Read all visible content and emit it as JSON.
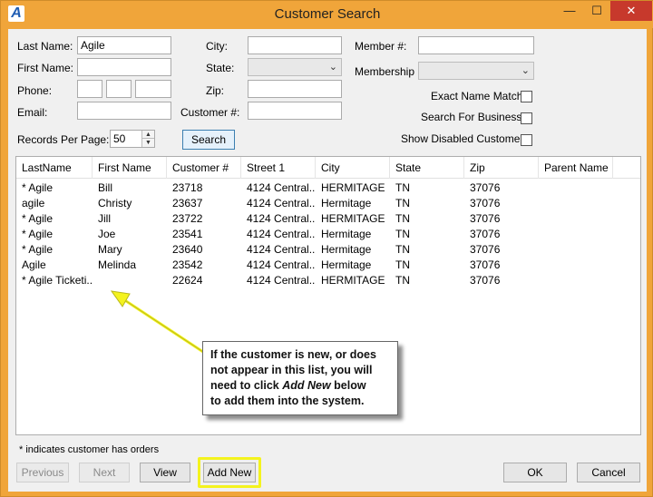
{
  "window": {
    "title": "Customer Search",
    "app_icon_letter": "A"
  },
  "titlebar_buttons": {
    "minimize": "—",
    "maximize": "☐",
    "close": "✕"
  },
  "form": {
    "last_name_label": "Last Name:",
    "last_name_value": "Agile",
    "first_name_label": "First Name:",
    "first_name_value": "",
    "phone_label": "Phone:",
    "email_label": "Email:",
    "email_value": "",
    "city_label": "City:",
    "city_value": "",
    "state_label": "State:",
    "zip_label": "Zip:",
    "zip_value": "",
    "customer_num_label": "Customer #:",
    "customer_num_value": "",
    "member_num_label": "Member #:",
    "member_num_value": "",
    "membership_label": "Membership",
    "exact_name_match_label": "Exact Name Match",
    "search_for_business_label": "Search For Business",
    "show_disabled_customer_label": "Show Disabled Customer",
    "records_per_page_label": "Records Per Page:",
    "records_per_page_value": "50",
    "search_button": "Search"
  },
  "grid": {
    "columns": [
      "LastName",
      "First Name",
      "Customer #",
      "Street 1",
      "City",
      "State",
      "Zip",
      "Parent Name"
    ],
    "rows": [
      [
        "* Agile",
        "Bill",
        "23718",
        "4124 Central...",
        "HERMITAGE",
        "TN",
        "37076",
        ""
      ],
      [
        "agile",
        "Christy",
        "23637",
        "4124 Central...",
        "Hermitage",
        "TN",
        "37076",
        ""
      ],
      [
        "* Agile",
        "Jill",
        "23722",
        "4124 Central...",
        "HERMITAGE",
        "TN",
        "37076",
        ""
      ],
      [
        "* Agile",
        "Joe",
        "23541",
        "4124 Central...",
        "Hermitage",
        "TN",
        "37076",
        ""
      ],
      [
        "* Agile",
        "Mary",
        "23640",
        "4124 Central...",
        "Hermitage",
        "TN",
        "37076",
        ""
      ],
      [
        "Agile",
        "Melinda",
        "23542",
        "4124 Central...",
        "Hermitage",
        "TN",
        "37076",
        ""
      ],
      [
        "* Agile Ticketi...",
        "",
        "22624",
        "4124 Central...",
        "HERMITAGE",
        "TN",
        "37076",
        ""
      ]
    ]
  },
  "annotation": {
    "line1": "If the customer is new, or does",
    "line2": "not appear in this list, you will",
    "line3_pre": "need to click ",
    "line3_em": "Add New",
    "line3_post": " below",
    "line4": "to add them into the system."
  },
  "footnote": "* indicates customer has orders",
  "buttons": {
    "previous": "Previous",
    "next": "Next",
    "view": "View",
    "add_new": "Add New",
    "ok": "OK",
    "cancel": "Cancel"
  },
  "colors": {
    "titlebar": "#f0a53a",
    "highlight": "#f4f31e",
    "arrow": "#f4f31e",
    "close_button": "#c7392c"
  }
}
